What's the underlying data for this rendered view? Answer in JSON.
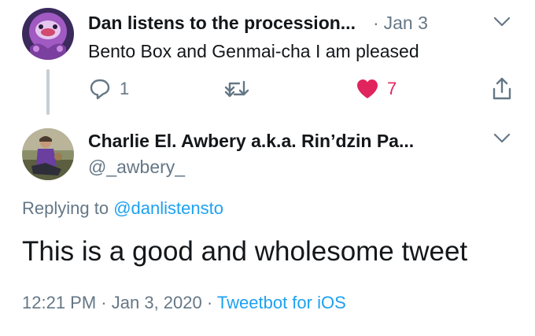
{
  "tweet1": {
    "author_name": "Dan listens to the procession...",
    "separator": "·",
    "date": "Jan 3",
    "text": "Bento Box and Genmai-cha I am pleased",
    "reply_count": "1",
    "like_count": "7"
  },
  "tweet2": {
    "author_name": "Charlie El. Awbery a.k.a. Rin’dzin Pa...",
    "handle": "@_awbery_",
    "replying_prefix": "Replying to",
    "replying_to": "@danlistensto",
    "text": "This is a good and wholesome tweet",
    "time": "12:21 PM",
    "dot1": "·",
    "date": "Jan 3, 2020",
    "dot2": "·",
    "source": "Tweetbot for iOS"
  },
  "colors": {
    "accent": "#1da1f2",
    "like": "#e0245e",
    "muted": "#657786",
    "text": "#14171a"
  },
  "icons": [
    "reply-icon",
    "retweet-icon",
    "heart-icon",
    "share-icon",
    "chevron-down-icon"
  ]
}
